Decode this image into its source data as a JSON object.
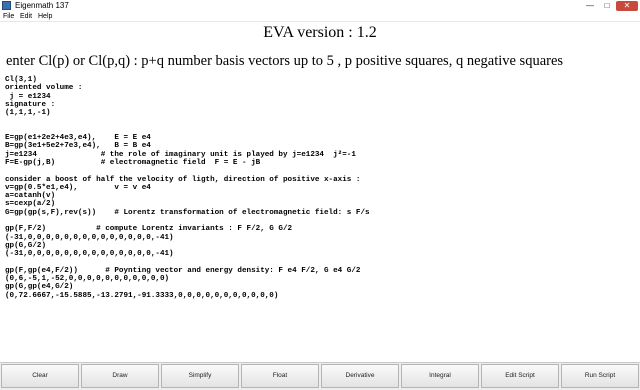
{
  "window": {
    "title": "Eigenmath 137",
    "minimize_glyph": "—",
    "maximize_glyph": "□",
    "close_glyph": "✕",
    "app_icon": "app-icon"
  },
  "menu": {
    "items": [
      {
        "label": "File"
      },
      {
        "label": "Edit"
      },
      {
        "label": "Help"
      }
    ]
  },
  "display": {
    "heading": "EVA version :  1.2",
    "subheading": "enter Cl(p) or Cl(p,q) :  p+q number basis vectors up to 5  , p positive squares, q negative squares",
    "lines": [
      "Cl(3,1)",
      "oriented volume :",
      " j = e1234",
      "signature :",
      "(1,1,1,-1)",
      "",
      "",
      "E=gp(e1+2e2+4e3,e4),    E = E e4",
      "B=gp(3e1+5e2+7e3,e4),   B = B e4",
      "j=e1234              # the role of imaginary unit is played by j=e1234  j²=-1",
      "F=E-gp(j,B)          # electromagnetic field  F = E - jB",
      "",
      "consider a boost of half the velocity of ligth, direction of positive x-axis :",
      "v=gp(0.5*e1,e4),        v = v e4",
      "a=catanh(v)",
      "s=cexp(a/2)",
      "G=gp(gp(s,F),rev(s))    # Lorentz transformation of electromagnetic field: s F/s",
      "",
      "gp(F,F/2)           # compute Lorentz invariants : F F/2, G G/2",
      "(-31,0,0,0,0,0,0,0,0,0,0,0,0,0,0,-41)",
      "gp(G,G/2)",
      "(-31,0,0,0,0,0,0,0,0,0,0,0,0,0,0,-41)",
      "",
      "gp(F,gp(e4,F/2))      # Poynting vector and energy density: F e4 F/2, G e4 G/2",
      "(0,6,-5,1,-52,0,0,0,0,0,0,0,0,0,0,0)",
      "gp(G,gp(e4,G/2)",
      "(0,72.6667,-15.5885,-13.2791,-91.3333,0,0,0,0,0,0,0,0,0,0,0)"
    ]
  },
  "buttons": [
    {
      "label": "Clear",
      "name": "clear-button"
    },
    {
      "label": "Draw",
      "name": "draw-button"
    },
    {
      "label": "Simplify",
      "name": "simplify-button"
    },
    {
      "label": "Float",
      "name": "float-button"
    },
    {
      "label": "Derivative",
      "name": "derivative-button"
    },
    {
      "label": "Integral",
      "name": "integral-button"
    },
    {
      "label": "Edit Script",
      "name": "edit-script-button"
    },
    {
      "label": "Run Script",
      "name": "run-script-button"
    }
  ]
}
